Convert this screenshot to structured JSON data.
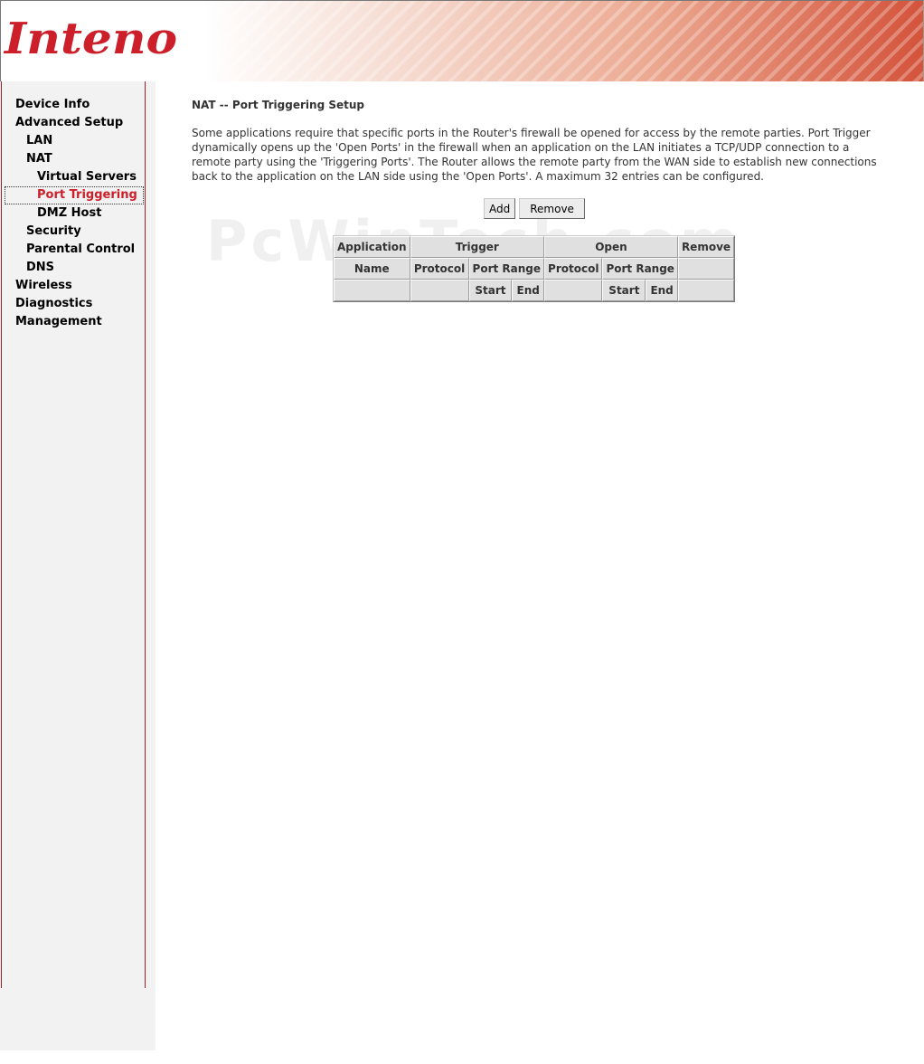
{
  "brand": {
    "logo_text": "Inteno"
  },
  "watermark": "PcWinTech.com",
  "nav": {
    "device_info": "Device Info",
    "advanced_setup": "Advanced Setup",
    "lan": "LAN",
    "nat": "NAT",
    "virtual_servers": "Virtual Servers",
    "port_triggering": "Port Triggering",
    "dmz_host": "DMZ Host",
    "security": "Security",
    "parental_control": "Parental Control",
    "dns": "DNS",
    "wireless": "Wireless",
    "diagnostics": "Diagnostics",
    "management": "Management"
  },
  "main": {
    "title": "NAT -- Port Triggering Setup",
    "description": "Some applications require that specific ports in the Router's firewall be opened for access by the remote parties. Port Trigger dynamically opens up the 'Open Ports' in the firewall when an application on the LAN initiates a TCP/UDP connection to a remote party using the 'Triggering Ports'. The Router allows the remote party from the WAN side to establish new connections back to the application on the LAN side using the 'Open Ports'. A maximum 32 entries can be configured.",
    "add_label": "Add",
    "remove_label": "Remove"
  },
  "table": {
    "application": "Application",
    "trigger": "Trigger",
    "open": "Open",
    "remove": "Remove",
    "name": "Name",
    "trigger_protocol": "Protocol",
    "trigger_port_range": "Port Range",
    "open_protocol": "Protocol",
    "open_port_range": "Port Range",
    "trigger_start": "Start",
    "trigger_end": "End",
    "open_start": "Start",
    "open_end": "End"
  },
  "colors": {
    "brand_red": "#cc1f2a",
    "sidebar_bg": "#f2f2f2",
    "table_bg": "#e0e0e0"
  }
}
